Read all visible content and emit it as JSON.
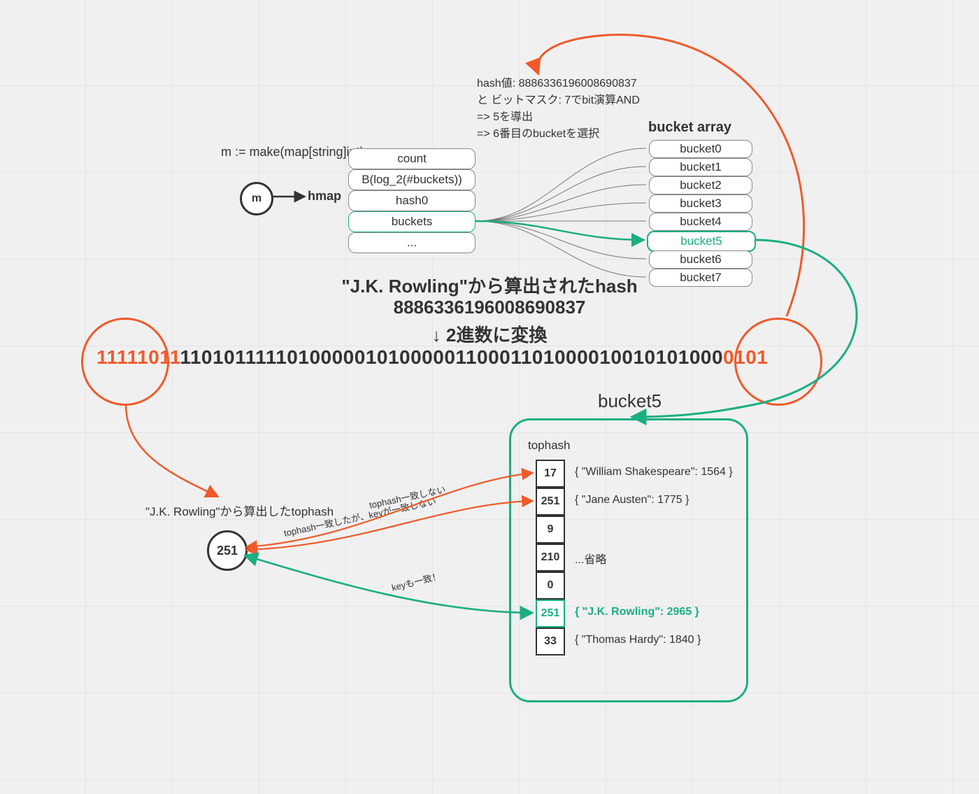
{
  "m_node": "m",
  "m_decl": "m := make(map[string]int)",
  "hmap_label": "hmap",
  "hmap_fields": [
    "count",
    "B(log_2(#buckets))",
    "hash0",
    "buckets",
    "..."
  ],
  "annot_hash": {
    "l1": "hash値: 8886336196008690837",
    "l2": "と ビットマスク: 7でbit演算AND",
    "l3": "=> 5を導出",
    "l4": "=> 6番目のbucketを選択"
  },
  "bucket_array_title": "bucket array",
  "buckets": [
    "bucket0",
    "bucket1",
    "bucket2",
    "bucket3",
    "bucket4",
    "bucket5",
    "bucket6",
    "bucket7"
  ],
  "hash_source_line": "\"J.K. Rowling\"から算出されたhash",
  "hash_decimal": "8886336196008690837",
  "binary_caption": "↓ 2進数に変換",
  "binary_hi": "11111011",
  "binary_mid": "1101011111010000010100000110001101000010010101000",
  "binary_lo": "0101",
  "bucket5_title": "bucket5",
  "tophash_label": "tophash",
  "tophash_cells": [
    "17",
    "251",
    "9",
    "210",
    "0",
    "251",
    "33"
  ],
  "kv_items": [
    "{ \"William Shakespeare\": 1564 }",
    "{ \"Jane Austen\": 1775 }",
    "",
    "...省略",
    "",
    "{ \"J.K. Rowling\": 2965 }",
    "{ \"Thomas Hardy\": 1840 }"
  ],
  "tophash_source": "\"J.K. Rowling\"から算出したtophash",
  "th_value": "251",
  "arrow_labels": {
    "no_match": "tophash一致しない",
    "key_no": "tophash一致したが、keyが一致しない",
    "key_yes": "keyも一致！"
  }
}
